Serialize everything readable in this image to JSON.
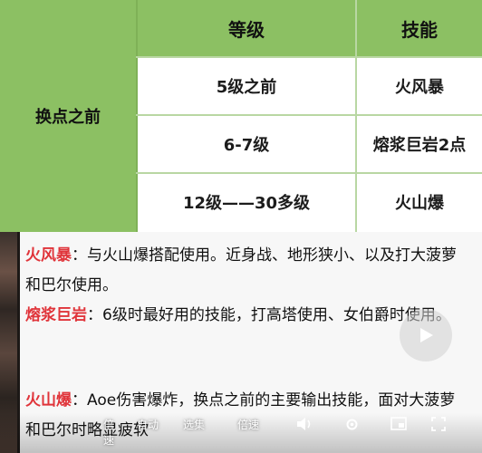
{
  "table": {
    "row_header": "换点之前",
    "headers": {
      "level": "等级",
      "skill": "技能"
    },
    "rows": [
      {
        "level": "5级之前",
        "skill": "火风暴"
      },
      {
        "level": "6-7级",
        "skill": "熔浆巨岩2点"
      },
      {
        "level": "12级——30多级",
        "skill": "火山爆"
      }
    ]
  },
  "notes": [
    {
      "term": "火风暴",
      "text": "：与火山爆搭配使用。近身战、地形狭小、以及打大菠萝和巴尔使用。"
    },
    {
      "term": "熔浆巨岩",
      "text": "：6级时最好用的技能，打高塔使用、女伯爵时使用。"
    },
    {
      "term": "火山爆",
      "text": "：Aoe伤害爆炸，换点之前的主要输出技能，面对大菠萝和巴尔时略显疲软"
    }
  ],
  "controls": {
    "speed_label": "倍速",
    "auto_label": "自动",
    "select_label": "选集",
    "quality_label": "倍速"
  },
  "colors": {
    "header_green": "#8cc063",
    "term_red": "#e0343a"
  }
}
